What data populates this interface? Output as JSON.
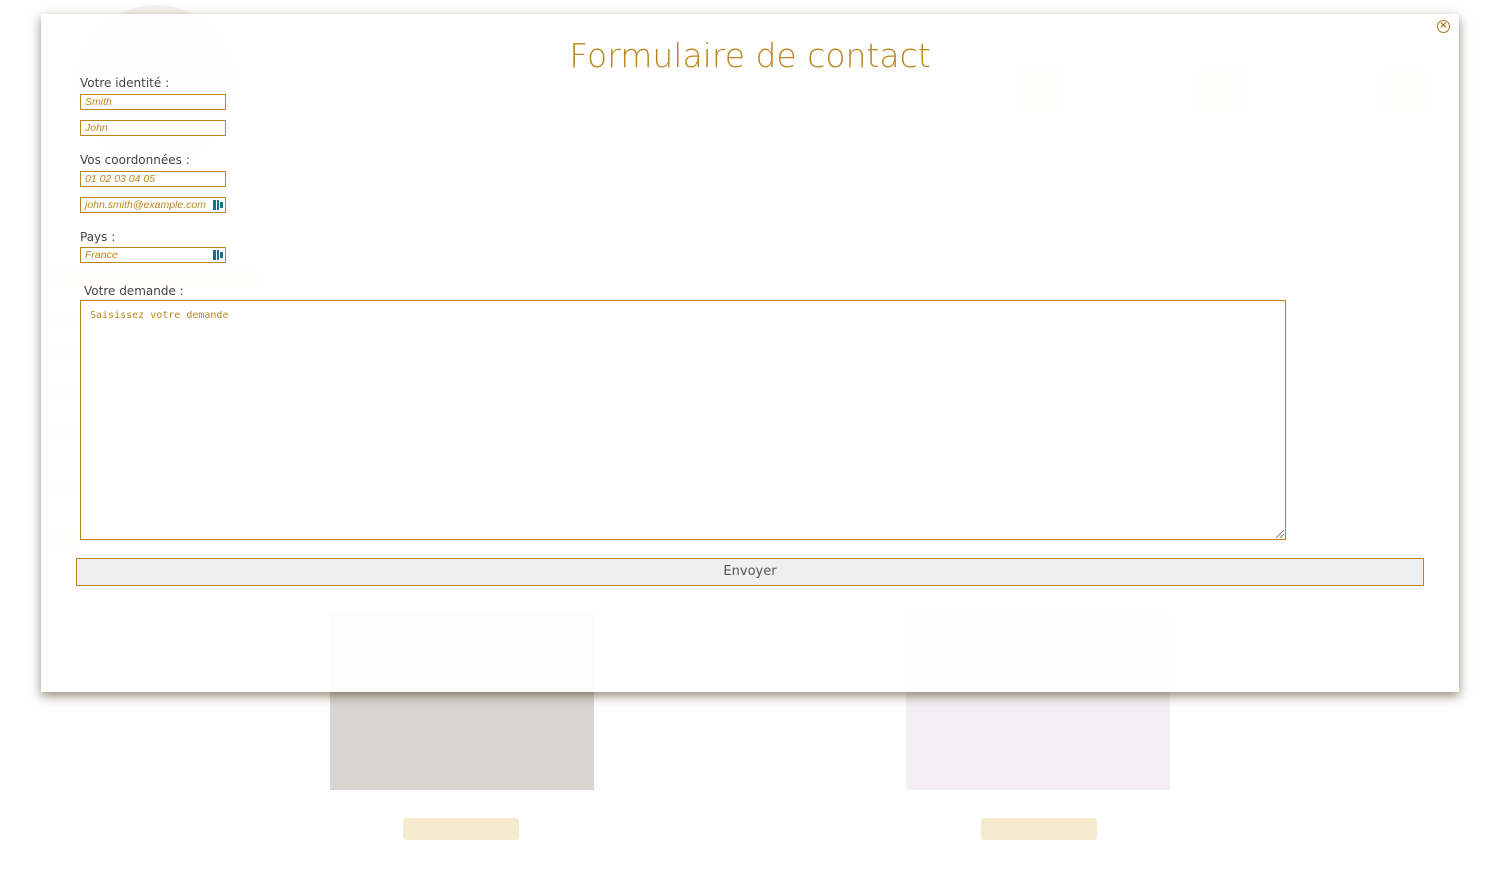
{
  "modal": {
    "title": "Formulaire de contact",
    "close_icon": "close-circle-icon",
    "identity_label": "Votre identité :",
    "last_name_placeholder": "Smith",
    "first_name_placeholder": "John",
    "contact_label": "Vos coordonnées :",
    "phone_placeholder": "01 02 03 04 05",
    "email_placeholder": "john.smith@example.com",
    "country_label": "Pays :",
    "country_value": "France",
    "request_label": "Votre demande :",
    "request_placeholder": "Saisissez votre demande",
    "submit_label": "Envoyer",
    "autofill_icon": "autofill-contact-icon"
  },
  "colors": {
    "accent": "#b8861d",
    "autofill": "#1e6f88"
  }
}
